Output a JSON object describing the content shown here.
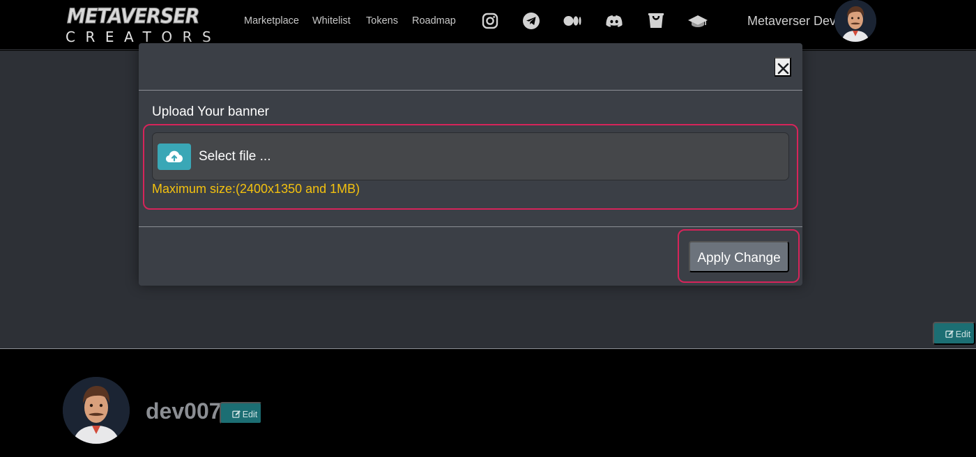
{
  "navbar": {
    "logo_top": "METAVERSER",
    "logo_bottom": "CREATORS",
    "links": [
      "Marketplace",
      "Whitelist",
      "Tokens",
      "Roadmap"
    ],
    "social_icons": [
      "instagram-icon",
      "telegram-icon",
      "medium-icon",
      "discord-icon",
      "shop-bag-icon",
      "hat-icon"
    ],
    "user_name": "Metaverser Dev"
  },
  "modal": {
    "upload_label": "Upload Your banner",
    "select_file": "Select file ...",
    "max_size": "Maximum size:(2400x1350 and 1MB)",
    "apply_button": "Apply Change"
  },
  "banner": {
    "edit_label": "Edit"
  },
  "profile": {
    "username": "dev007",
    "edit_label": "Edit"
  },
  "colors": {
    "accent_teal": "#1c6e73",
    "upload_teal": "#3aa7b6",
    "warning_yellow": "#f3c10f",
    "highlight_red": "#d6245a",
    "modal_bg": "#3b3f46"
  }
}
